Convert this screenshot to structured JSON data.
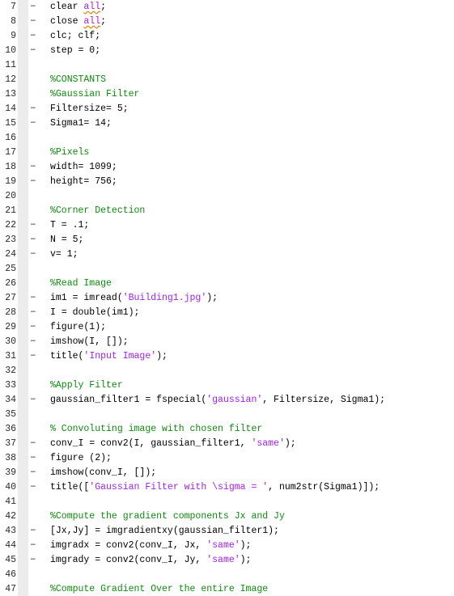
{
  "editor": {
    "name": "matlab-code-editor",
    "first_visible_line": 7,
    "last_visible_line": 47,
    "colors": {
      "background": "#ffffff",
      "text": "#000000",
      "comment": "#0e8a0e",
      "string": "#a020f0",
      "keyword": "#a020f0",
      "line_number": "#2b2b2b",
      "gutter_strip": "#ececec",
      "warning_squiggle": "#e08000"
    },
    "lines": [
      {
        "number": "7",
        "marker": "−",
        "tokens": [
          {
            "text": "clear ",
            "type": "plain"
          },
          {
            "text": "all",
            "type": "warn"
          },
          {
            "text": ";",
            "type": "plain"
          }
        ]
      },
      {
        "number": "8",
        "marker": "−",
        "tokens": [
          {
            "text": "close ",
            "type": "plain"
          },
          {
            "text": "all",
            "type": "warn"
          },
          {
            "text": ";",
            "type": "plain"
          }
        ]
      },
      {
        "number": "9",
        "marker": "−",
        "tokens": [
          {
            "text": "clc; clf;",
            "type": "plain"
          }
        ]
      },
      {
        "number": "10",
        "marker": "−",
        "tokens": [
          {
            "text": "step = 0;",
            "type": "plain"
          }
        ]
      },
      {
        "number": "11",
        "marker": "",
        "tokens": []
      },
      {
        "number": "12",
        "marker": "",
        "tokens": [
          {
            "text": "%CONSTANTS",
            "type": "comment"
          }
        ]
      },
      {
        "number": "13",
        "marker": "",
        "tokens": [
          {
            "text": "%Gaussian Filter",
            "type": "comment"
          }
        ]
      },
      {
        "number": "14",
        "marker": "−",
        "tokens": [
          {
            "text": "Filtersize= 5;",
            "type": "plain"
          }
        ]
      },
      {
        "number": "15",
        "marker": "−",
        "tokens": [
          {
            "text": "Sigma1= 14;",
            "type": "plain"
          }
        ]
      },
      {
        "number": "16",
        "marker": "",
        "tokens": []
      },
      {
        "number": "17",
        "marker": "",
        "tokens": [
          {
            "text": "%Pixels",
            "type": "comment"
          }
        ]
      },
      {
        "number": "18",
        "marker": "−",
        "tokens": [
          {
            "text": "width= 1099;",
            "type": "plain"
          }
        ]
      },
      {
        "number": "19",
        "marker": "−",
        "tokens": [
          {
            "text": "height= 756;",
            "type": "plain"
          }
        ]
      },
      {
        "number": "20",
        "marker": "",
        "tokens": []
      },
      {
        "number": "21",
        "marker": "",
        "tokens": [
          {
            "text": "%Corner Detection",
            "type": "comment"
          }
        ]
      },
      {
        "number": "22",
        "marker": "−",
        "tokens": [
          {
            "text": "T = .1;",
            "type": "plain"
          }
        ]
      },
      {
        "number": "23",
        "marker": "−",
        "tokens": [
          {
            "text": "N = 5;",
            "type": "plain"
          }
        ]
      },
      {
        "number": "24",
        "marker": "−",
        "tokens": [
          {
            "text": "v= 1;",
            "type": "plain"
          }
        ]
      },
      {
        "number": "25",
        "marker": "",
        "tokens": []
      },
      {
        "number": "26",
        "marker": "",
        "tokens": [
          {
            "text": "%Read Image",
            "type": "comment"
          }
        ]
      },
      {
        "number": "27",
        "marker": "−",
        "tokens": [
          {
            "text": "im1 = imread(",
            "type": "plain"
          },
          {
            "text": "'Building1.jpg'",
            "type": "string"
          },
          {
            "text": ");",
            "type": "plain"
          }
        ]
      },
      {
        "number": "28",
        "marker": "−",
        "tokens": [
          {
            "text": "I = double(im1);",
            "type": "plain"
          }
        ]
      },
      {
        "number": "29",
        "marker": "−",
        "tokens": [
          {
            "text": "figure(1);",
            "type": "plain"
          }
        ]
      },
      {
        "number": "30",
        "marker": "−",
        "tokens": [
          {
            "text": "imshow(I, []);",
            "type": "plain"
          }
        ]
      },
      {
        "number": "31",
        "marker": "−",
        "tokens": [
          {
            "text": "title(",
            "type": "plain"
          },
          {
            "text": "'Input Image'",
            "type": "string"
          },
          {
            "text": ");",
            "type": "plain"
          }
        ]
      },
      {
        "number": "32",
        "marker": "",
        "tokens": []
      },
      {
        "number": "33",
        "marker": "",
        "tokens": [
          {
            "text": "%Apply Filter",
            "type": "comment"
          }
        ]
      },
      {
        "number": "34",
        "marker": "−",
        "tokens": [
          {
            "text": "gaussian_filter1 = fspecial(",
            "type": "plain"
          },
          {
            "text": "'gaussian'",
            "type": "string"
          },
          {
            "text": ", Filtersize, Sigma1);",
            "type": "plain"
          }
        ]
      },
      {
        "number": "35",
        "marker": "",
        "tokens": []
      },
      {
        "number": "36",
        "marker": "",
        "tokens": [
          {
            "text": "% Convoluting image with chosen filter",
            "type": "comment"
          }
        ]
      },
      {
        "number": "37",
        "marker": "−",
        "tokens": [
          {
            "text": "conv_I = conv2(I, gaussian_filter1, ",
            "type": "plain"
          },
          {
            "text": "'same'",
            "type": "string"
          },
          {
            "text": ");",
            "type": "plain"
          }
        ]
      },
      {
        "number": "38",
        "marker": "−",
        "tokens": [
          {
            "text": "figure (2);",
            "type": "plain"
          }
        ]
      },
      {
        "number": "39",
        "marker": "−",
        "tokens": [
          {
            "text": "imshow(conv_I, []);",
            "type": "plain"
          }
        ]
      },
      {
        "number": "40",
        "marker": "−",
        "tokens": [
          {
            "text": "title([",
            "type": "plain"
          },
          {
            "text": "'Gaussian Filter with \\sigma = '",
            "type": "string"
          },
          {
            "text": ", num2str(Sigma1)]);",
            "type": "plain"
          }
        ]
      },
      {
        "number": "41",
        "marker": "",
        "tokens": []
      },
      {
        "number": "42",
        "marker": "",
        "tokens": [
          {
            "text": "%Compute the gradient components Jx and Jy",
            "type": "comment"
          }
        ]
      },
      {
        "number": "43",
        "marker": "−",
        "tokens": [
          {
            "text": "[Jx,Jy] = imgradientxy(gaussian_filter1);",
            "type": "plain"
          }
        ]
      },
      {
        "number": "44",
        "marker": "−",
        "tokens": [
          {
            "text": "imgradx = conv2(conv_I, Jx, ",
            "type": "plain"
          },
          {
            "text": "'same'",
            "type": "string"
          },
          {
            "text": ");",
            "type": "plain"
          }
        ]
      },
      {
        "number": "45",
        "marker": "−",
        "tokens": [
          {
            "text": "imgrady = conv2(conv_I, Jy, ",
            "type": "plain"
          },
          {
            "text": "'same'",
            "type": "string"
          },
          {
            "text": ");",
            "type": "plain"
          }
        ]
      },
      {
        "number": "46",
        "marker": "",
        "tokens": []
      },
      {
        "number": "47",
        "marker": "",
        "tokens": [
          {
            "text": "%Compute Gradient Over the entire Image",
            "type": "comment"
          }
        ]
      }
    ]
  }
}
